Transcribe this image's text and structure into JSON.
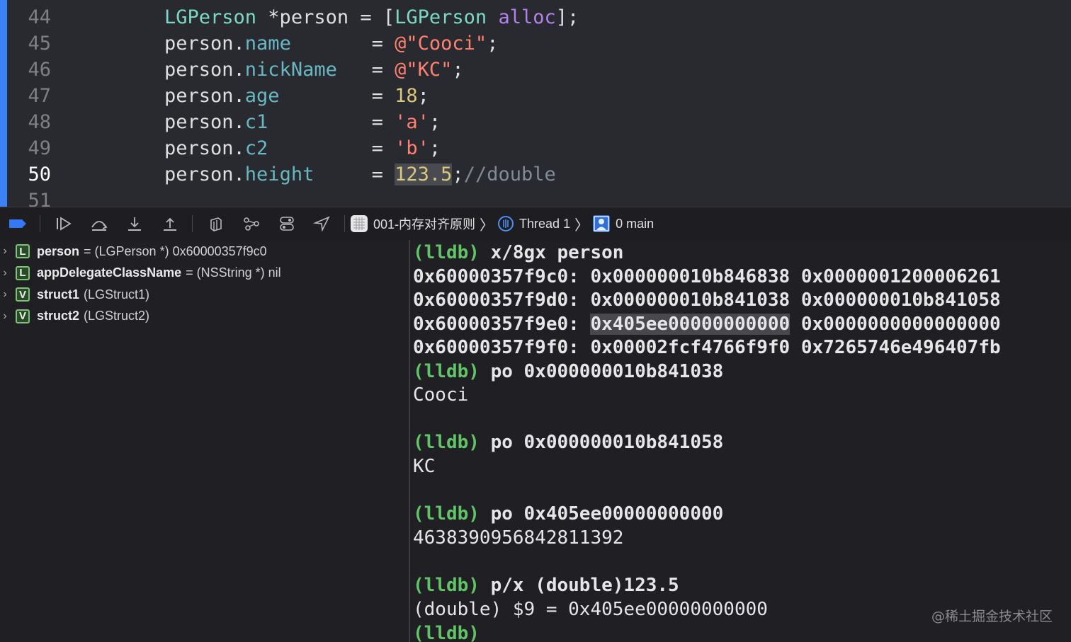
{
  "editor": {
    "lines": [
      {
        "num": "44",
        "parts": [
          [
            "cls",
            "LGPerson"
          ],
          [
            "plain",
            " *person = ["
          ],
          [
            "cls",
            "LGPerson"
          ],
          [
            "plain",
            " "
          ],
          [
            "msg",
            "alloc"
          ],
          [
            "plain",
            "];"
          ]
        ]
      },
      {
        "num": "45",
        "parts": [
          [
            "plain",
            "person."
          ],
          [
            "prop",
            "name"
          ],
          [
            "plain",
            "       = "
          ],
          [
            "str",
            "@\"Cooci\""
          ],
          [
            "plain",
            ";"
          ]
        ]
      },
      {
        "num": "46",
        "parts": [
          [
            "plain",
            "person."
          ],
          [
            "prop",
            "nickName"
          ],
          [
            "plain",
            "   = "
          ],
          [
            "str",
            "@\"KC\""
          ],
          [
            "plain",
            ";"
          ]
        ]
      },
      {
        "num": "47",
        "parts": [
          [
            "plain",
            "person."
          ],
          [
            "prop",
            "age"
          ],
          [
            "plain",
            "        = "
          ],
          [
            "num",
            "18"
          ],
          [
            "plain",
            ";"
          ]
        ]
      },
      {
        "num": "48",
        "parts": [
          [
            "plain",
            "person."
          ],
          [
            "prop",
            "c1"
          ],
          [
            "plain",
            "         = "
          ],
          [
            "str",
            "'a'"
          ],
          [
            "plain",
            ";"
          ]
        ]
      },
      {
        "num": "49",
        "parts": [
          [
            "plain",
            "person."
          ],
          [
            "prop",
            "c2"
          ],
          [
            "plain",
            "         = "
          ],
          [
            "str",
            "'b'"
          ],
          [
            "plain",
            ";"
          ]
        ]
      },
      {
        "num": "50",
        "current": true,
        "parts": [
          [
            "plain",
            "person."
          ],
          [
            "prop",
            "height"
          ],
          [
            "plain",
            "     = "
          ],
          [
            "numhl",
            "123.5"
          ],
          [
            "plain",
            ";"
          ],
          [
            "cmt",
            "//double"
          ]
        ]
      },
      {
        "num": "51",
        "parts": []
      }
    ]
  },
  "debugbar": {
    "scheme_label": "001-内存对齐原则",
    "thread_label": "Thread 1",
    "frame_label": "0 main"
  },
  "variables": [
    {
      "kind": "L",
      "name": "person",
      "detail": "= (LGPerson *) 0x60000357f9c0"
    },
    {
      "kind": "L",
      "name": "appDelegateClassName",
      "detail": "= (NSString *) nil"
    },
    {
      "kind": "V",
      "name": "struct1",
      "detail": "(LGStruct1)"
    },
    {
      "kind": "V",
      "name": "struct2",
      "detail": "(LGStruct2)"
    }
  ],
  "console": {
    "lines": [
      {
        "prompt": "(lldb)",
        "text": " x/8gx person"
      },
      {
        "text": "0x60000357f9c0: 0x000000010b846838 0x0000001200006261"
      },
      {
        "text": "0x60000357f9d0: 0x000000010b841038 0x000000010b841058"
      },
      {
        "pre": "0x60000357f9e0: ",
        "sel": "0x405ee00000000000",
        "post": " 0x0000000000000000"
      },
      {
        "text": "0x60000357f9f0: 0x00002fcf4766f9f0 0x7265746e496407fb"
      },
      {
        "prompt": "(lldb)",
        "text": " po 0x000000010b841038"
      },
      {
        "out": "Cooci"
      },
      {
        "out": ""
      },
      {
        "prompt": "(lldb)",
        "text": " po 0x000000010b841058"
      },
      {
        "out": "KC"
      },
      {
        "out": ""
      },
      {
        "prompt": "(lldb)",
        "text": " po 0x405ee00000000000"
      },
      {
        "out": "4638390956842811392"
      },
      {
        "out": ""
      },
      {
        "prompt": "(lldb)",
        "text": " p/x (double)123.5"
      },
      {
        "out": "(double) $9 = 0x405ee00000000000"
      },
      {
        "prompt": "(lldb)",
        "text": ""
      }
    ]
  },
  "watermark": "@稀土掘金技术社区"
}
